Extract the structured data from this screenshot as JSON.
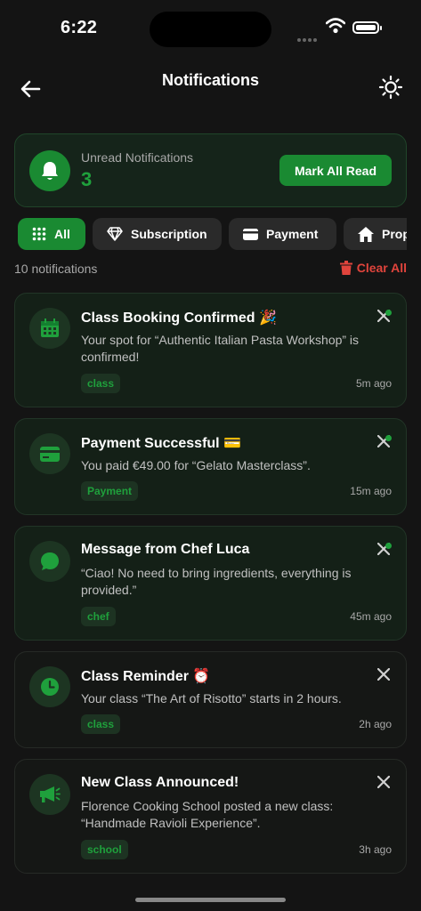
{
  "status_bar": {
    "time": "6:22"
  },
  "header": {
    "title": "Notifications"
  },
  "summary": {
    "label": "Unread Notifications",
    "count": "3",
    "button": "Mark All Read"
  },
  "filters": [
    {
      "label": "All",
      "icon": "grid-icon",
      "active": true
    },
    {
      "label": "Subscription",
      "icon": "diamond-icon",
      "active": false
    },
    {
      "label": "Payment",
      "icon": "credit-card-icon",
      "active": false
    },
    {
      "label": "Prop",
      "icon": "home-icon",
      "active": false
    }
  ],
  "list_info": {
    "count_text": "10 notifications",
    "clear_all": "Clear All"
  },
  "notifications": [
    {
      "title": "Class Booking Confirmed 🎉",
      "body": "Your spot for “Authentic Italian Pasta Workshop” is confirmed!",
      "tag": "class",
      "time": "5m ago",
      "unread": true,
      "icon": "calendar-icon"
    },
    {
      "title": "Payment Successful 💳",
      "body": "You paid €49.00 for “Gelato Masterclass”.",
      "tag": "Payment",
      "time": "15m ago",
      "unread": true,
      "icon": "credit-card-icon"
    },
    {
      "title": "Message from Chef Luca",
      "body": "“Ciao! No need to bring ingredients, everything is provided.”",
      "tag": "chef",
      "time": "45m ago",
      "unread": true,
      "icon": "chat-icon"
    },
    {
      "title": "Class Reminder ⏰",
      "body": "Your class “The Art of Risotto” starts in 2 hours.",
      "tag": "class",
      "time": "2h ago",
      "unread": false,
      "icon": "clock-icon"
    },
    {
      "title": "New Class Announced!",
      "body": "Florence Cooking School posted a new class: “Handmade Ravioli Experience”.",
      "tag": "school",
      "time": "3h ago",
      "unread": false,
      "icon": "megaphone-icon"
    }
  ],
  "colors": {
    "accent": "#1a8a32",
    "accent_text": "#1fa03c",
    "danger": "#e0443c",
    "background": "#141414"
  }
}
